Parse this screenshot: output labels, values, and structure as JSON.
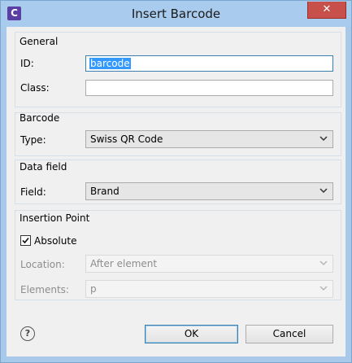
{
  "window": {
    "app_icon_letter": "C",
    "title": "Insert Barcode",
    "close_glyph": "✕"
  },
  "general": {
    "title": "General",
    "id_label": "ID:",
    "id_value": "barcode",
    "class_label": "Class:",
    "class_value": ""
  },
  "barcode": {
    "title": "Barcode",
    "type_label": "Type:",
    "type_value": "Swiss QR Code"
  },
  "data_field": {
    "title": "Data field",
    "field_label": "Field:",
    "field_value": "Brand"
  },
  "insertion": {
    "title": "Insertion Point",
    "absolute_label": "Absolute",
    "absolute_checked": true,
    "location_label": "Location:",
    "location_value": "After element",
    "elements_label": "Elements:",
    "elements_value": "p"
  },
  "footer": {
    "help_glyph": "?",
    "ok_label": "OK",
    "cancel_label": "Cancel"
  }
}
